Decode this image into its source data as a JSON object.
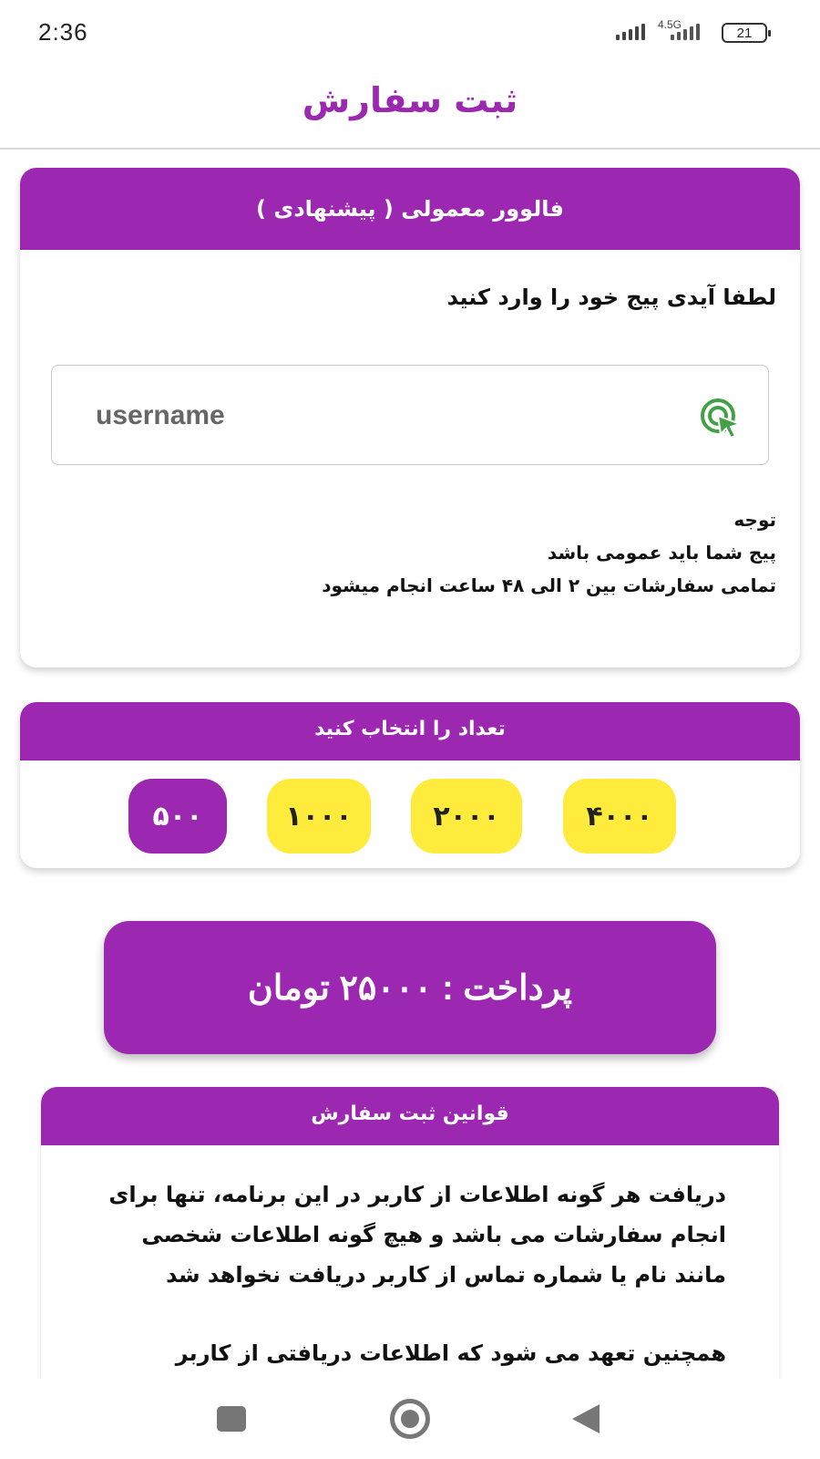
{
  "status_bar": {
    "time": "2:36",
    "network": "4.5G",
    "battery": "21"
  },
  "app_bar": {
    "title": "ثبت سفارش"
  },
  "service_card": {
    "header": "فالوور معمولی ( پیشنهادی )",
    "prompt": "لطفا آیدی پیج خود را وارد کنید",
    "input": {
      "placeholder": "username",
      "value": ""
    },
    "note_title": "توجه",
    "note_lines": [
      "پیج شما باید عمومی باشد",
      "تمامی سفارشات بین ۲ الی ۴۸ ساعت انجام میشود"
    ]
  },
  "quantity_card": {
    "header": "تعداد را انتخاب کنید",
    "options": [
      "۴۰۰۰",
      "۲۰۰۰",
      "۱۰۰۰",
      "۵۰۰"
    ],
    "selected": "۵۰۰"
  },
  "pay_button": {
    "label": "پرداخت :  ۲۵۰۰۰  تومان"
  },
  "rules_card": {
    "header": "قوانین ثبت سفارش",
    "paragraphs": [
      "دریافت هر گونه اطلاعات از کاربر در این برنامه، تنها برای انجام سفارشات می باشد و هیچ گونه اطلاعات شخصی مانند نام یا شماره تماس از کاربر دریافت نخواهد شد",
      "همچنین تعهد می شود که اطلاعات دریافتی از کاربر"
    ]
  },
  "colors": {
    "primary": "#9c27b0",
    "chip": "#ffeb3b",
    "icon_green": "#43a047"
  },
  "icons": {
    "recent": "square-recent-apps-icon",
    "home": "circle-home-icon",
    "back": "triangle-back-icon",
    "input": "target-cursor-icon"
  }
}
